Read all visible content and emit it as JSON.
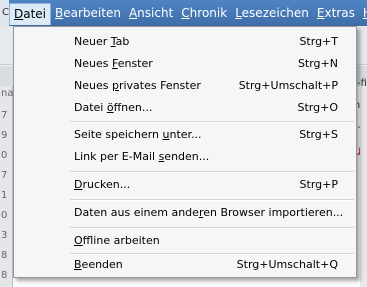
{
  "menubar": {
    "left_stub": "C",
    "items": [
      {
        "label": "Datei",
        "accel": "D",
        "rest": "atei"
      },
      {
        "label": "Bearbeiten",
        "accel": "B",
        "rest": "earbeiten"
      },
      {
        "label": "Ansicht",
        "accel": "A",
        "rest": "nsicht"
      },
      {
        "label": "Chronik",
        "accel": "C",
        "rest": "hronik"
      },
      {
        "label": "Lesezeichen",
        "accel": "L",
        "rest": "esezeichen"
      },
      {
        "label": "Extras",
        "accel": "E",
        "rest": "xtras"
      },
      {
        "label": "Hilfe",
        "accel": "H",
        "rest": "ilf"
      }
    ]
  },
  "background": {
    "left_numbers": [
      "7",
      "9",
      "0",
      "7",
      "1",
      "0",
      "3",
      "8",
      "8",
      "8"
    ],
    "right_fragments": [
      "-fi",
      "n -",
      "- i",
      "ur"
    ],
    "left_label": "na"
  },
  "menu": {
    "items": [
      {
        "pre": "Neuer ",
        "accel": "T",
        "post": "ab",
        "shortcut": "Strg+T"
      },
      {
        "pre": "Neues ",
        "accel": "F",
        "post": "enster",
        "shortcut": "Strg+N"
      },
      {
        "pre": "Neues ",
        "accel": "p",
        "post": "rivates Fenster",
        "shortcut": "Strg+Umschalt+P"
      },
      {
        "pre": "Datei ",
        "accel": "ö",
        "post": "ffnen...",
        "shortcut": "Strg+O"
      },
      {
        "pre": "Seite speichern ",
        "accel": "u",
        "post": "nter...",
        "shortcut": "Strg+S"
      },
      {
        "pre": "Link per E-Mail ",
        "accel": "s",
        "post": "enden...",
        "shortcut": ""
      },
      {
        "pre": "",
        "accel": "D",
        "post": "rucken...",
        "shortcut": "Strg+P"
      },
      {
        "pre": "Daten aus einem ande",
        "accel": "r",
        "post": "en Browser importieren...",
        "shortcut": ""
      },
      {
        "pre": "",
        "accel": "O",
        "post": "ffline arbeiten",
        "shortcut": ""
      },
      {
        "pre": "",
        "accel": "B",
        "post": "eenden",
        "shortcut": "Strg+Umschalt+Q"
      }
    ]
  }
}
